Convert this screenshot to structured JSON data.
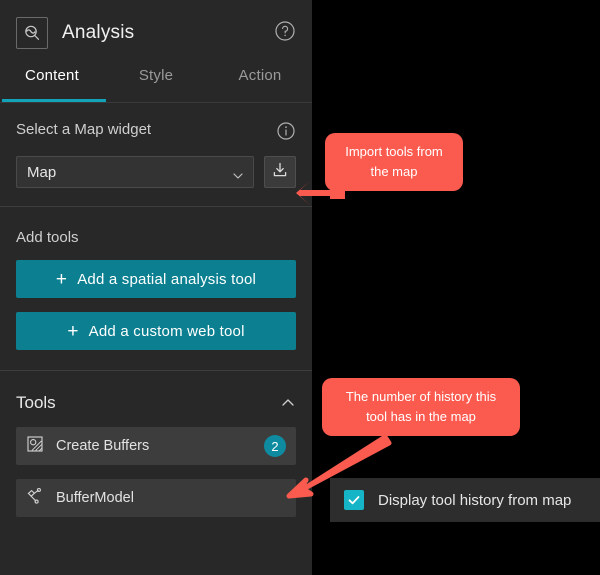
{
  "panel": {
    "header": {
      "title": "Analysis",
      "app_icon": "analysis-icon",
      "help_icon": "help-circle-icon"
    },
    "tabs": [
      {
        "label": "Content",
        "active": true
      },
      {
        "label": "Style",
        "active": false
      },
      {
        "label": "Action",
        "active": false
      }
    ],
    "map_section": {
      "label": "Select a Map widget",
      "info_icon": "info-circle-icon",
      "select_value": "Map",
      "select_options": [
        "Map"
      ],
      "import_button_icon": "download-icon"
    },
    "add_tools_section": {
      "label": "Add tools",
      "buttons": [
        {
          "label": "Add a spatial analysis tool",
          "icon": "plus-icon"
        },
        {
          "label": "Add a custom web tool",
          "icon": "plus-icon"
        }
      ]
    },
    "tools_section": {
      "label": "Tools",
      "collapse_icon": "chevron-up-icon",
      "items": [
        {
          "name": "Create Buffers",
          "icon": "buffer-icon",
          "badge": "2"
        },
        {
          "name": "BufferModel",
          "icon": "model-icon",
          "badge": ""
        }
      ]
    }
  },
  "checkbox": {
    "label": "Display tool history from map",
    "checked": true
  },
  "callouts": [
    {
      "id": "import",
      "text": "Import tools from the map"
    },
    {
      "id": "history",
      "text": "The number of history this tool has in the map"
    }
  ],
  "colors": {
    "panel_bg": "#282828",
    "page_bg": "#000000",
    "accent_teal": "#0c7f90",
    "accent_teal_bright": "#13a3b8",
    "badge_teal": "#0e8ba0",
    "checkbox_teal": "#15b4c6",
    "callout_red": "#fb5b4f",
    "divider": "#3d3d3d"
  }
}
